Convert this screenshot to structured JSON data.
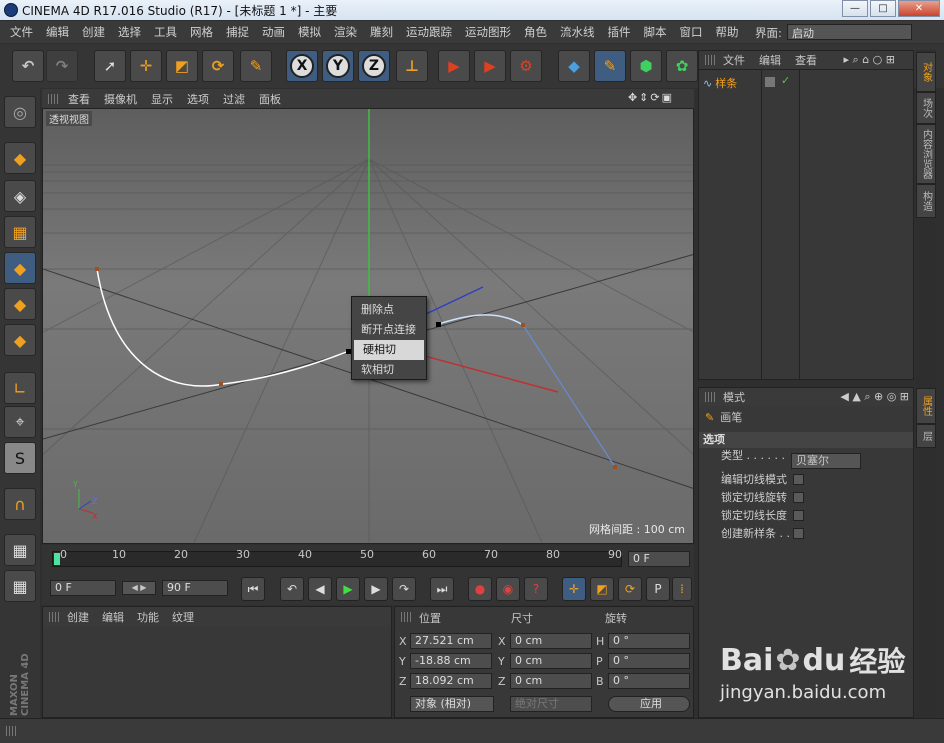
{
  "window": {
    "title": "CINEMA 4D R17.016 Studio (R17) - [未标题 1 *] - 主要"
  },
  "menubar": {
    "items": [
      "文件",
      "编辑",
      "创建",
      "选择",
      "工具",
      "网格",
      "捕捉",
      "动画",
      "模拟",
      "渲染",
      "雕刻",
      "运动跟踪",
      "运动图形",
      "角色",
      "流水线",
      "插件",
      "脚本",
      "窗口",
      "帮助"
    ],
    "layout_label": "界面:",
    "layout_value": "启动"
  },
  "toolbar": {
    "axis_x": "X",
    "axis_y": "Y",
    "axis_z": "Z"
  },
  "viewport": {
    "menu": [
      "查看",
      "摄像机",
      "显示",
      "选项",
      "过滤",
      "面板"
    ],
    "view_name": "透视视图",
    "grid_spacing": "网格间距 : 100 cm"
  },
  "context_menu": {
    "items": [
      "删除点",
      "断开点连接",
      "硬相切",
      "软相切"
    ],
    "highlighted_index": 2
  },
  "timeline": {
    "ticks": [
      "0",
      "10",
      "20",
      "30",
      "40",
      "50",
      "60",
      "70",
      "80",
      "90"
    ],
    "current_frame": "0 F"
  },
  "playback": {
    "start_frame": "0 F",
    "end_frame": "90 F"
  },
  "material_panel": {
    "menu": [
      "创建",
      "编辑",
      "功能",
      "纹理"
    ]
  },
  "coord_panel": {
    "headers": [
      "位置",
      "尺寸",
      "旋转"
    ],
    "rows": [
      {
        "axis": "X",
        "pos": "27.521 cm",
        "size_axis": "X",
        "size": "0 cm",
        "rot_axis": "H",
        "rot": "0 °"
      },
      {
        "axis": "Y",
        "pos": "-18.88 cm",
        "size_axis": "Y",
        "size": "0 cm",
        "rot_axis": "P",
        "rot": "0 °"
      },
      {
        "axis": "Z",
        "pos": "18.092 cm",
        "size_axis": "Z",
        "size": "0 cm",
        "rot_axis": "B",
        "rot": "0 °"
      }
    ],
    "mode": "对象 (相对)",
    "size_mode": "绝对尺寸",
    "apply": "应用"
  },
  "object_panel": {
    "menu": [
      "文件",
      "编辑",
      "查看"
    ],
    "object_name": "样条"
  },
  "attr_panel": {
    "menu": [
      "模式"
    ],
    "tool_name": "画笔",
    "section": "选项",
    "type_label": "类型 . . . . . . .",
    "type_value": "贝塞尔",
    "options": [
      "编辑切线模式",
      "锁定切线旋转",
      "锁定切线长度",
      "创建新样条 . ."
    ]
  },
  "right_tabs": {
    "upper": [
      "对象",
      "场次",
      "内容浏览器",
      "构造"
    ],
    "lower": [
      "属性",
      "层"
    ]
  },
  "branding": {
    "left": "MAXON CINEMA 4D"
  },
  "watermark": {
    "brand": "Bai",
    "paw": "du",
    "jingyan": "经验",
    "url": "jingyan.baidu.com"
  },
  "colors": {
    "accent": "#f0a020",
    "highlight": "#d8d8d8",
    "spline": "#ffffff"
  }
}
